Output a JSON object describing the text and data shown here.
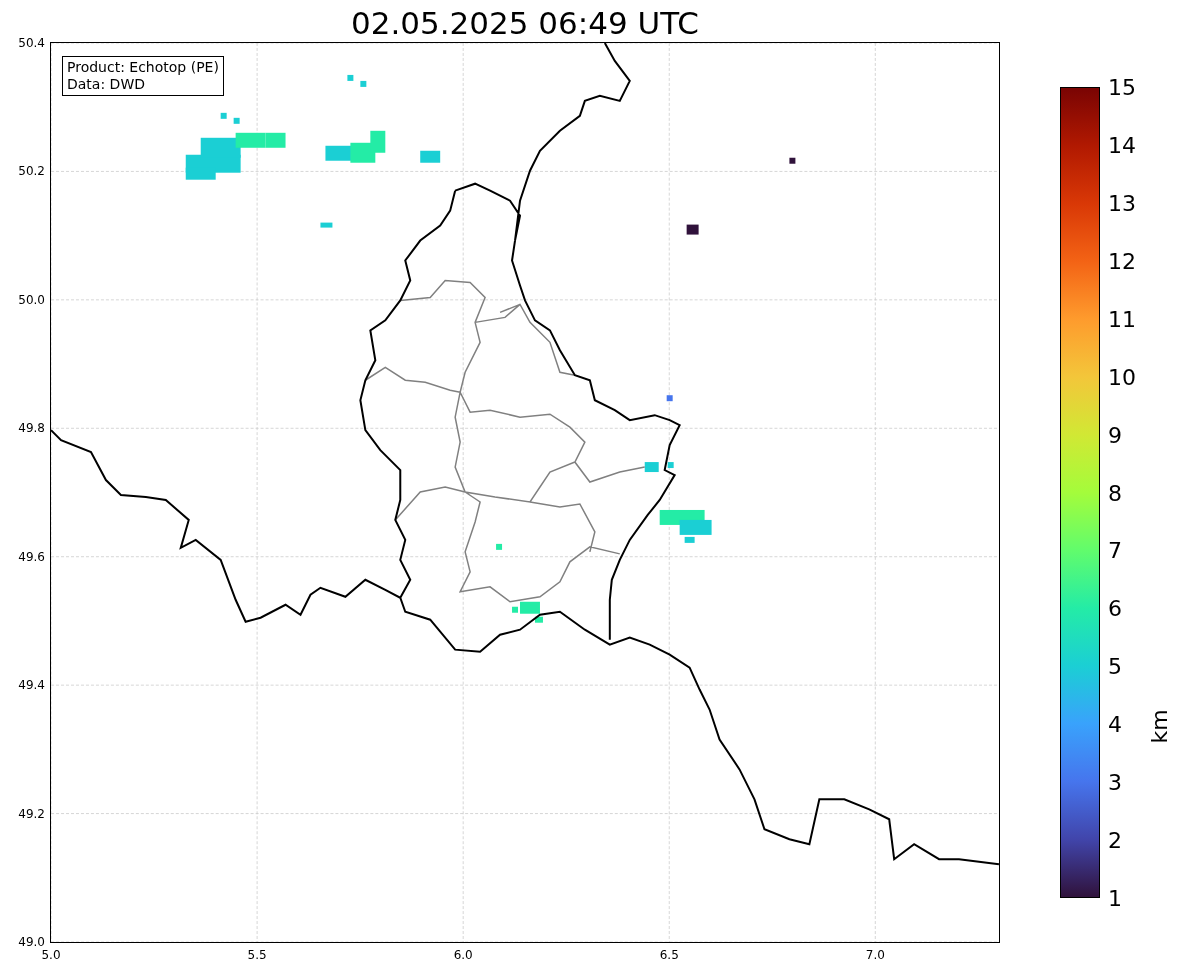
{
  "title": "02.05.2025 06:49 UTC",
  "legend": {
    "lines": [
      "Product: Echotop (PE)",
      "Data: DWD"
    ]
  },
  "map": {
    "xticks": [
      "5.0",
      "5.5",
      "6.0",
      "6.5",
      "7.0"
    ],
    "yticks": [
      "50.4",
      "50.2",
      "50.0",
      "49.8",
      "49.6",
      "49.4",
      "49.2",
      "49.0"
    ]
  },
  "colorbar": {
    "ticks": [
      "15",
      "14",
      "13",
      "12",
      "11",
      "10",
      "9",
      "8",
      "7",
      "6",
      "5",
      "4",
      "3",
      "2",
      "1"
    ],
    "label": "km"
  }
}
